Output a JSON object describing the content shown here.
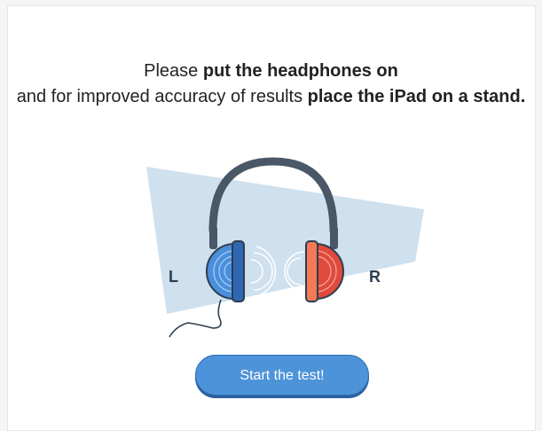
{
  "instructions": {
    "part1": "Please ",
    "bold1": "put the headphones on",
    "part2": " and for improved accuracy of results ",
    "bold2": "place the iPad on a stand."
  },
  "illustration": {
    "left_label": "L",
    "right_label": "R",
    "icon": "headphones-icon",
    "left_color": "#4a8fdc",
    "right_color": "#e04a3c",
    "beam_color": "#cfe0ee"
  },
  "button": {
    "start_label": "Start the test!"
  }
}
